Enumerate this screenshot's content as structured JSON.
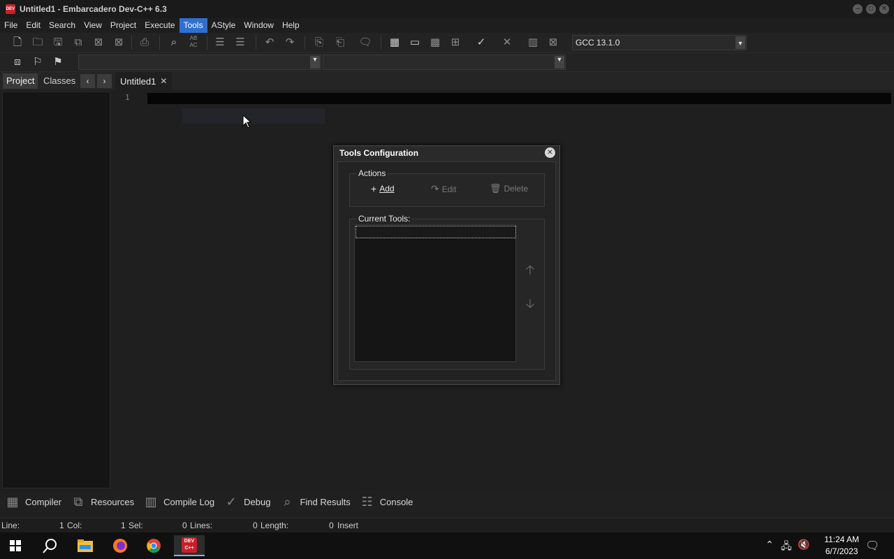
{
  "window": {
    "app_icon_text": "DEV",
    "title": "Untitled1 - Embarcadero Dev-C++ 6.3",
    "controls": [
      "minimize-icon",
      "maximize-icon",
      "close-icon"
    ]
  },
  "menu": {
    "items": [
      "File",
      "Edit",
      "Search",
      "View",
      "Project",
      "Execute",
      "Tools",
      "AStyle",
      "Window",
      "Help"
    ],
    "active": "Tools"
  },
  "toolbar": {
    "compiler_select": "GCC 13.1.0",
    "icons": [
      "new-file-icon",
      "open-icon",
      "save-icon",
      "save-all-icon",
      "close-file-icon",
      "close-all-icon",
      "print-icon",
      "find-icon",
      "replace-icon",
      "indent-icon",
      "unindent-icon",
      "undo-icon",
      "redo-icon",
      "toggle-comment-icon",
      "uncomment-icon",
      "bookmark-icon",
      "compile-icon",
      "run-icon",
      "compile-run-icon",
      "rebuild-icon",
      "syntax-check-icon",
      "stop-icon",
      "profile-icon",
      "delete-profile-icon"
    ],
    "row2_icons": [
      "goto-icon",
      "toggle-bookmark-icon",
      "goto-bookmark-icon"
    ]
  },
  "left_panel": {
    "tabs": [
      "Project",
      "Classes"
    ],
    "active_tab": "Project",
    "nav_prev": "‹",
    "nav_next": "›"
  },
  "editor": {
    "tab_label": "Untitled1",
    "tab_close": "✕",
    "line_numbers": [
      "1"
    ]
  },
  "dialog": {
    "title": "Tools Configuration",
    "close": "✕",
    "actions_group": "Actions",
    "add_label": "Add",
    "edit_label": "Edit",
    "delete_label": "Delete",
    "current_tools_label": "Current Tools:",
    "tools": [],
    "move_up": "🡡",
    "move_down": "🡣"
  },
  "bottom_tabs": [
    {
      "label": "Compiler",
      "icon": "compiler-grid-icon"
    },
    {
      "label": "Resources",
      "icon": "resources-icon"
    },
    {
      "label": "Compile Log",
      "icon": "compile-log-icon"
    },
    {
      "label": "Debug",
      "icon": "debug-check-icon"
    },
    {
      "label": "Find Results",
      "icon": "find-results-icon"
    },
    {
      "label": "Console",
      "icon": "console-icon"
    }
  ],
  "status": {
    "line_label": "Line:",
    "line_value": "1",
    "col_label": "Col:",
    "col_value": "1",
    "sel_label": "Sel:",
    "sel_value": "0",
    "lines_label": "Lines:",
    "lines_value": "0",
    "length_label": "Length:",
    "length_value": "0",
    "mode": "Insert"
  },
  "taskbar": {
    "apps": [
      "start-icon",
      "search-icon",
      "file-explorer-icon",
      "firefox-icon",
      "chrome-icon",
      "devcpp-icon"
    ],
    "devcpp_text": "DEV C++",
    "time": "11:24 AM",
    "date": "6/7/2023"
  }
}
